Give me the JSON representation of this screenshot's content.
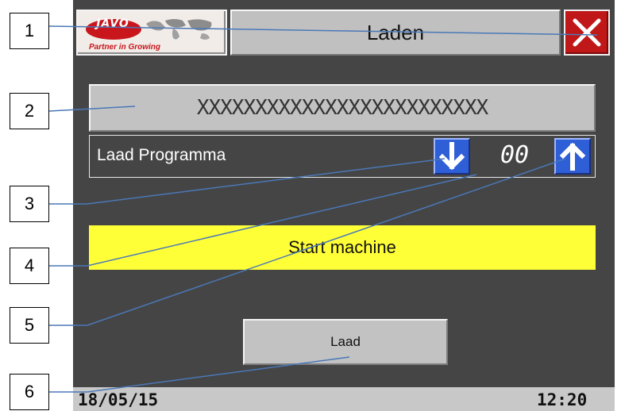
{
  "header": {
    "logo_word": "JAVO",
    "logo_tagline": "Partner in Growing",
    "title": "Laden"
  },
  "program": {
    "name_placeholder": "XXXXXXXXXXXXXXXXXXXXXXXXX",
    "label": "Laad Programma",
    "value": "00"
  },
  "start_banner": "Start machine",
  "load_button": "Laad",
  "status": {
    "date": "18/05/15",
    "time": "12:20"
  },
  "callouts": [
    "1",
    "2",
    "3",
    "4",
    "5",
    "6"
  ],
  "colors": {
    "panel": "#454545",
    "banner": "#ffff37",
    "close": "#c01818",
    "arrow": "#2f5fd6"
  },
  "icons": {
    "close": "close-icon",
    "down": "arrow-down-icon",
    "up": "arrow-up-icon"
  }
}
